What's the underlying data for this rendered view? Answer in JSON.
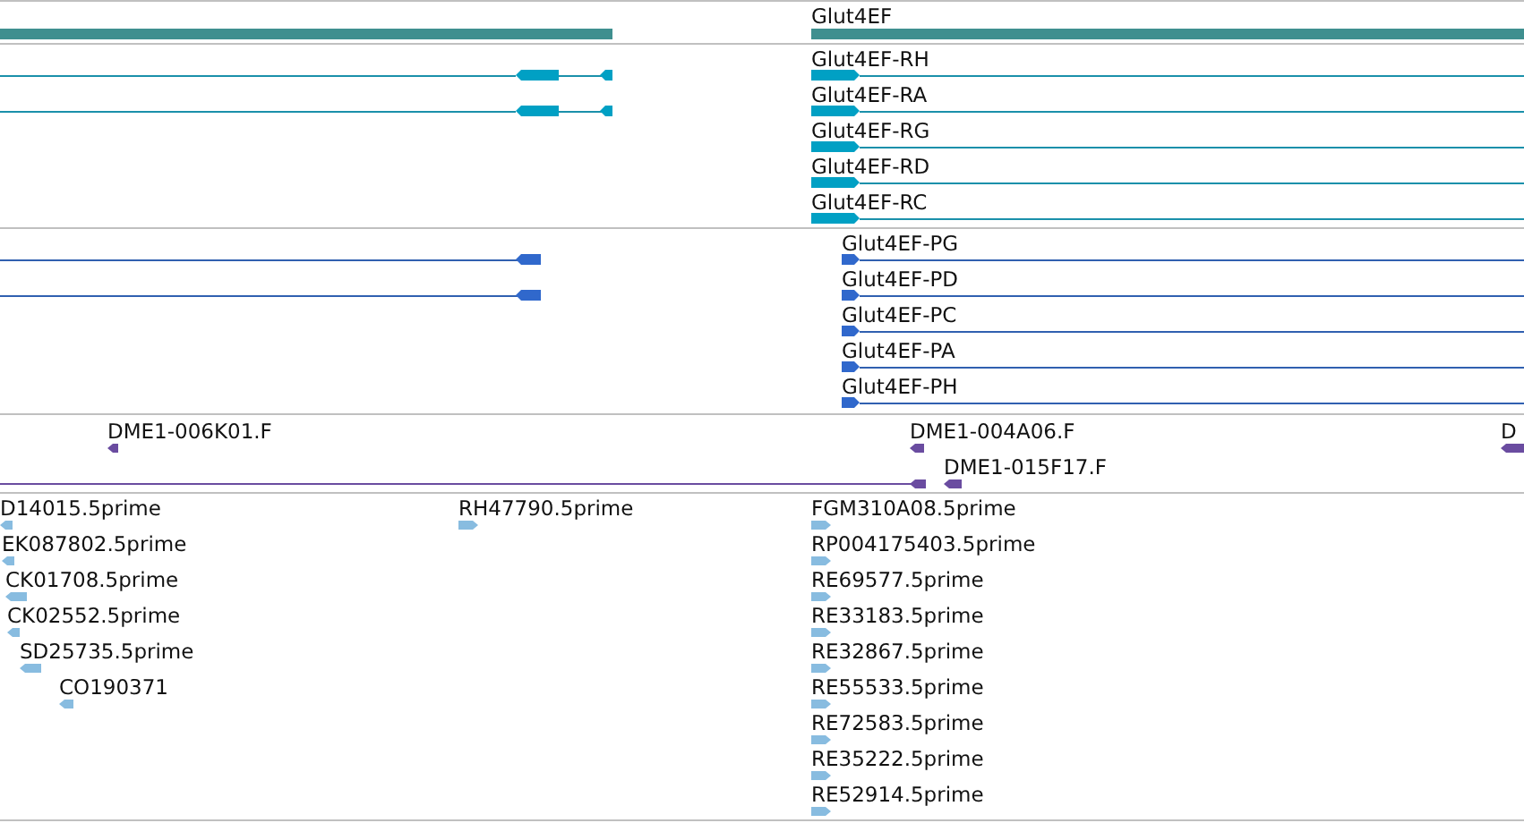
{
  "tracks": [
    {
      "kind": "gene",
      "features": [
        {
          "label": "Glut4EF"
        }
      ]
    },
    {
      "kind": "transcript",
      "features": [
        {
          "label": "Glut4EF-RH",
          "reverse": false
        },
        {
          "label": "Glut4EF-RA",
          "reverse": false
        },
        {
          "label": "Glut4EF-RG",
          "reverse": false
        },
        {
          "label": "Glut4EF-RD",
          "reverse": false
        },
        {
          "label": "Glut4EF-RC",
          "reverse": false
        }
      ]
    },
    {
      "kind": "protein",
      "features": [
        {
          "label": "Glut4EF-PG",
          "reverse": false
        },
        {
          "label": "Glut4EF-PD",
          "reverse": false
        },
        {
          "label": "Glut4EF-PC",
          "reverse": false
        },
        {
          "label": "Glut4EF-PA",
          "reverse": false
        },
        {
          "label": "Glut4EF-PH",
          "reverse": false
        }
      ]
    },
    {
      "kind": "clone_end",
      "features": [
        {
          "label": "DME1-006K01.F",
          "reverse": true
        },
        {
          "label": "DME1-004A06.F",
          "reverse": true
        },
        {
          "label": "D",
          "reverse": true
        },
        {
          "label": "DME1-015F17.F",
          "reverse": true
        }
      ]
    },
    {
      "kind": "est",
      "features": [
        {
          "label": "D14015.5prime",
          "reverse": true
        },
        {
          "label": "EK087802.5prime",
          "reverse": true
        },
        {
          "label": "CK01708.5prime",
          "reverse": true
        },
        {
          "label": "CK02552.5prime",
          "reverse": true
        },
        {
          "label": "SD25735.5prime",
          "reverse": true
        },
        {
          "label": "CO190371",
          "reverse": true
        },
        {
          "label": "RH47790.5prime",
          "reverse": false
        },
        {
          "label": "FGM310A08.5prime",
          "reverse": false
        },
        {
          "label": "RP004175403.5prime",
          "reverse": false
        },
        {
          "label": "RE69577.5prime",
          "reverse": false
        },
        {
          "label": "RE33183.5prime",
          "reverse": false
        },
        {
          "label": "RE32867.5prime",
          "reverse": false
        },
        {
          "label": "RE55533.5prime",
          "reverse": false
        },
        {
          "label": "RE72583.5prime",
          "reverse": false
        },
        {
          "label": "RE35222.5prime",
          "reverse": false
        },
        {
          "label": "RE52914.5prime",
          "reverse": false
        }
      ]
    }
  ]
}
